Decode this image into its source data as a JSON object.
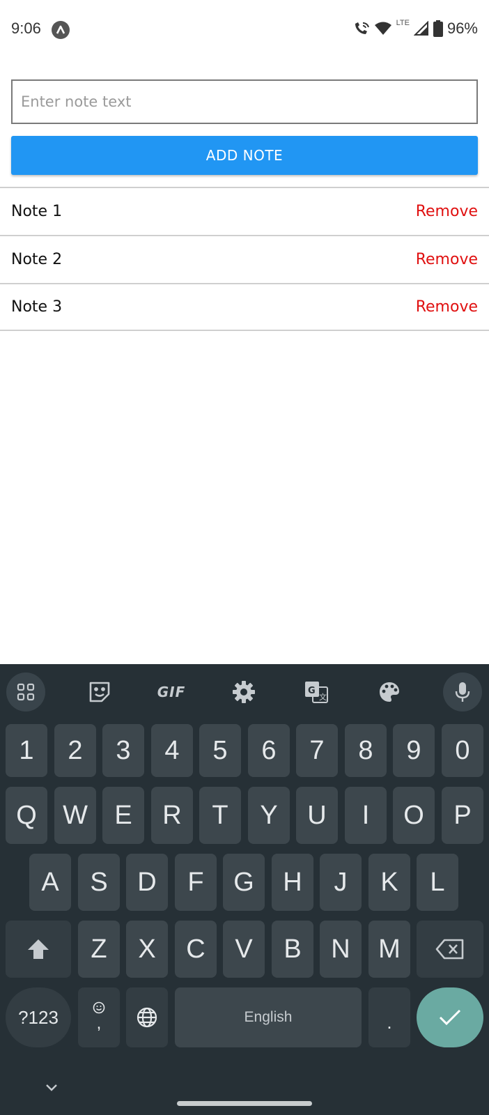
{
  "status_bar": {
    "time": "9:06",
    "network_label": "LTE",
    "battery": "96%"
  },
  "note_form": {
    "input_value": "",
    "input_placeholder": "Enter note text",
    "add_button_label": "ADD NOTE",
    "add_button_color": "#2196f3"
  },
  "notes": [
    {
      "text": "Note 1",
      "action": "Remove"
    },
    {
      "text": "Note 2",
      "action": "Remove"
    },
    {
      "text": "Note 3",
      "action": "Remove"
    }
  ],
  "remove_color": "#e01010",
  "keyboard": {
    "toolbar_icons": [
      "apps-grid-icon",
      "sticker-icon",
      "gif-icon",
      "settings-gear-icon",
      "translate-icon",
      "palette-icon",
      "microphone-icon"
    ],
    "gif_label": "GIF",
    "number_row": [
      "1",
      "2",
      "3",
      "4",
      "5",
      "6",
      "7",
      "8",
      "9",
      "0"
    ],
    "row1": [
      "Q",
      "W",
      "E",
      "R",
      "T",
      "Y",
      "U",
      "I",
      "O",
      "P"
    ],
    "row2": [
      "A",
      "S",
      "D",
      "F",
      "G",
      "H",
      "J",
      "K",
      "L"
    ],
    "row3": [
      "Z",
      "X",
      "C",
      "V",
      "B",
      "N",
      "M"
    ],
    "symbols_label": "?123",
    "comma_label": ",",
    "space_label": "English",
    "period_label": ".",
    "enter_color": "#6aaaa2"
  }
}
